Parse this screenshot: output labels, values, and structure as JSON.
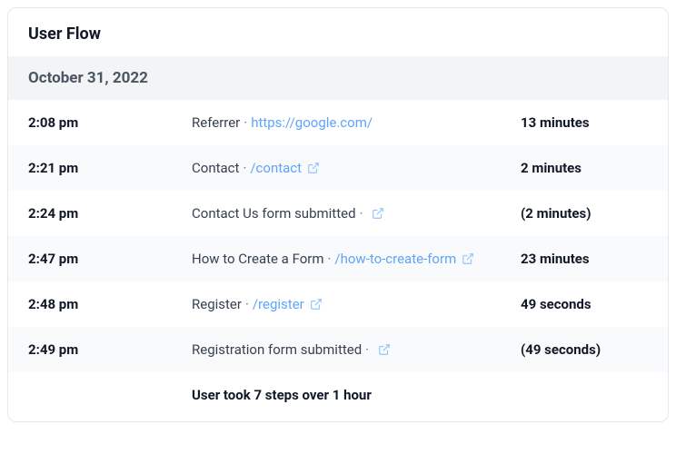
{
  "title": "User Flow",
  "date_header": "October 31, 2022",
  "rows": [
    {
      "time": "2:08 pm",
      "label": "Referrer",
      "link": "https://google.com/",
      "has_ext_icon": false,
      "duration": "13 minutes",
      "striped": false
    },
    {
      "time": "2:21 pm",
      "label": "Contact",
      "link": "/contact",
      "has_ext_icon": true,
      "duration": "2 minutes",
      "striped": true
    },
    {
      "time": "2:24 pm",
      "label": "Contact Us form submitted",
      "link": "",
      "has_ext_icon": true,
      "duration": "(2 minutes)",
      "striped": false
    },
    {
      "time": "2:47 pm",
      "label": "How to Create a Form",
      "link": "/how-to-create-form",
      "has_ext_icon": true,
      "duration": "23 minutes",
      "striped": true
    },
    {
      "time": "2:48 pm",
      "label": "Register",
      "link": "/register",
      "has_ext_icon": true,
      "duration": "49 seconds",
      "striped": false
    },
    {
      "time": "2:49 pm",
      "label": "Registration form submitted",
      "link": "",
      "has_ext_icon": true,
      "duration": "(49 seconds)",
      "striped": true
    }
  ],
  "summary": "User took 7 steps over 1 hour"
}
